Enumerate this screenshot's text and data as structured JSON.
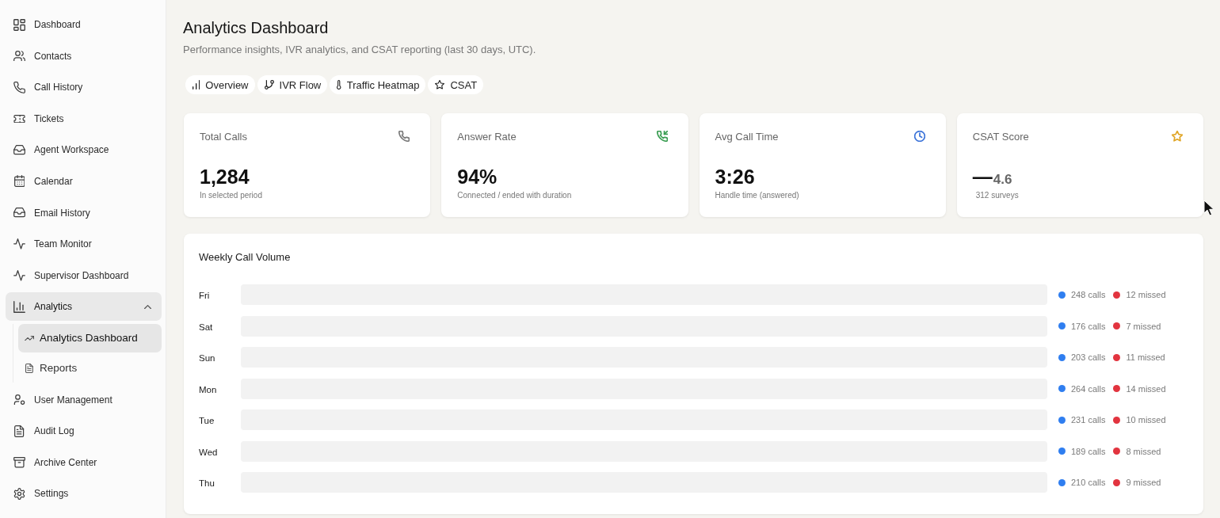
{
  "sidebar": {
    "items": [
      {
        "label": "Dashboard",
        "selected": false
      },
      {
        "label": "Contacts",
        "selected": false
      },
      {
        "label": "Call History",
        "selected": false
      },
      {
        "label": "Tickets",
        "selected": false
      },
      {
        "label": "Agent Workspace",
        "selected": false
      },
      {
        "label": "Calendar",
        "selected": false
      },
      {
        "label": "Email History",
        "selected": false
      },
      {
        "label": "Team Monitor",
        "selected": false
      },
      {
        "label": "Supervisor Dashboard",
        "selected": false
      },
      {
        "label": "Analytics",
        "selected": true,
        "expanded": true,
        "children": [
          {
            "label": "Analytics Dashboard",
            "selected": true
          },
          {
            "label": "Reports",
            "selected": false
          }
        ]
      },
      {
        "label": "User Management",
        "selected": false
      },
      {
        "label": "Audit Log",
        "selected": false
      },
      {
        "label": "Archive Center",
        "selected": false
      },
      {
        "label": "Settings",
        "selected": false
      }
    ]
  },
  "header": {
    "title": "Analytics Dashboard",
    "subtitle": "Performance insights, IVR analytics, and CSAT reporting (last 30 days, UTC)."
  },
  "tabs": [
    {
      "label": "Overview",
      "selected": false
    },
    {
      "label": "IVR Flow",
      "selected": false
    },
    {
      "label": "Traffic Heatmap",
      "selected": false
    },
    {
      "label": "CSAT",
      "selected": false
    }
  ],
  "cards": [
    {
      "title": "Total Calls",
      "value": "1,284",
      "caption": "In selected period",
      "color": "#7a7a7a"
    },
    {
      "title": "Answer Rate",
      "value": "94%",
      "caption": "Connected / ended with duration",
      "color": "#3a9d52"
    },
    {
      "title": "Avg Call Time",
      "value": "3:26",
      "caption": "Handle time (answered)",
      "color": "#3b73d9"
    },
    {
      "title": "CSAT Score",
      "value": "—",
      "score": "4.6",
      "caption": "312 surveys",
      "color": "#e0a526"
    }
  ],
  "weekly_call_volume": {
    "title": "Weekly Call Volume",
    "rows": [
      {
        "day": "Fri",
        "stats": [
          {
            "text": "248 calls",
            "color": "#2f7ef0"
          },
          {
            "text": "12 missed",
            "color": "#e2343f"
          }
        ]
      },
      {
        "day": "Sat",
        "stats": [
          {
            "text": "176 calls",
            "color": "#2f7ef0"
          },
          {
            "text": "7 missed",
            "color": "#e2343f"
          }
        ]
      },
      {
        "day": "Sun",
        "stats": [
          {
            "text": "203 calls",
            "color": "#2f7ef0"
          },
          {
            "text": "11 missed",
            "color": "#e2343f"
          }
        ]
      },
      {
        "day": "Mon",
        "stats": [
          {
            "text": "264 calls",
            "color": "#2f7ef0"
          },
          {
            "text": "14 missed",
            "color": "#e2343f"
          }
        ]
      },
      {
        "day": "Tue",
        "stats": [
          {
            "text": "231 calls",
            "color": "#2f7ef0"
          },
          {
            "text": "10 missed",
            "color": "#e2343f"
          }
        ]
      },
      {
        "day": "Wed",
        "stats": [
          {
            "text": "189 calls",
            "color": "#2f7ef0"
          },
          {
            "text": "8 missed",
            "color": "#e2343f"
          }
        ]
      },
      {
        "day": "Thu",
        "stats": [
          {
            "text": "210 calls",
            "color": "#2f7ef0"
          },
          {
            "text": "9 missed",
            "color": "#e2343f"
          }
        ]
      }
    ]
  }
}
